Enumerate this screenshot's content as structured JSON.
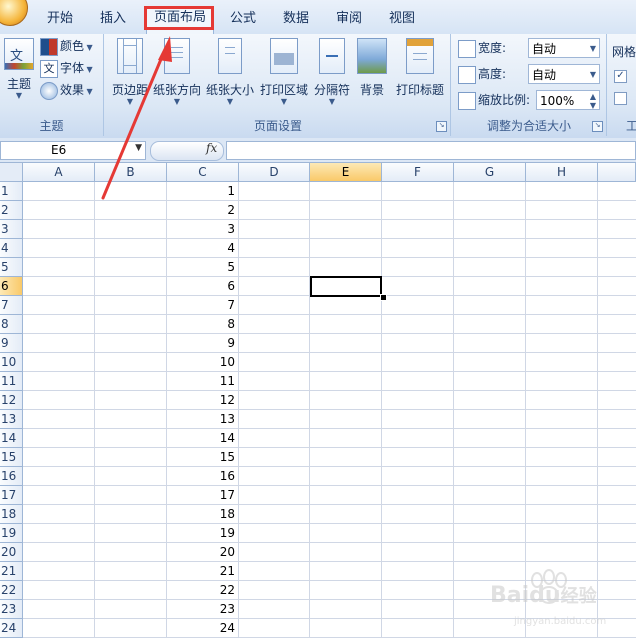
{
  "tabs": [
    "开始",
    "插入",
    "页面布局",
    "公式",
    "数据",
    "审阅",
    "视图"
  ],
  "active_tab": "页面布局",
  "ribbon": {
    "theme_group": {
      "label": "主题",
      "big_button": "主题",
      "colors": "颜色",
      "fonts": "字体",
      "effects": "效果"
    },
    "page_setup_group": {
      "label": "页面设置",
      "buttons": [
        "页边距",
        "纸张方向",
        "纸张大小",
        "打印区域",
        "分隔符",
        "背景",
        "打印标题"
      ]
    },
    "scale_group": {
      "label": "调整为合适大小",
      "width_label": "宽度:",
      "width_value": "自动",
      "height_label": "高度:",
      "height_value": "自动",
      "scale_label": "缩放比例:",
      "scale_value": "100%"
    },
    "sheet_options_group": {
      "label": "工",
      "gridlines_label": "网格"
    }
  },
  "formula_bar": {
    "name_box": "E6",
    "fx": "fx",
    "formula": ""
  },
  "grid": {
    "columns": [
      "A",
      "B",
      "C",
      "D",
      "E",
      "F",
      "G",
      "H"
    ],
    "selected_column": "E",
    "selected_row": "6",
    "rows": [
      "1",
      "2",
      "3",
      "4",
      "5",
      "6",
      "7",
      "8",
      "9",
      "10",
      "11",
      "12",
      "13",
      "14",
      "15",
      "16",
      "17",
      "18",
      "19",
      "20",
      "21",
      "22",
      "23",
      "24"
    ],
    "column_c_values": [
      "1",
      "2",
      "3",
      "4",
      "5",
      "6",
      "7",
      "8",
      "9",
      "10",
      "11",
      "12",
      "13",
      "14",
      "15",
      "16",
      "17",
      "18",
      "19",
      "20",
      "21",
      "22",
      "23",
      "24"
    ]
  },
  "watermark": {
    "brand": "Baidu",
    "text": "经验",
    "url": "jingyan.baidu.com"
  },
  "annotation_color": "#e53935"
}
